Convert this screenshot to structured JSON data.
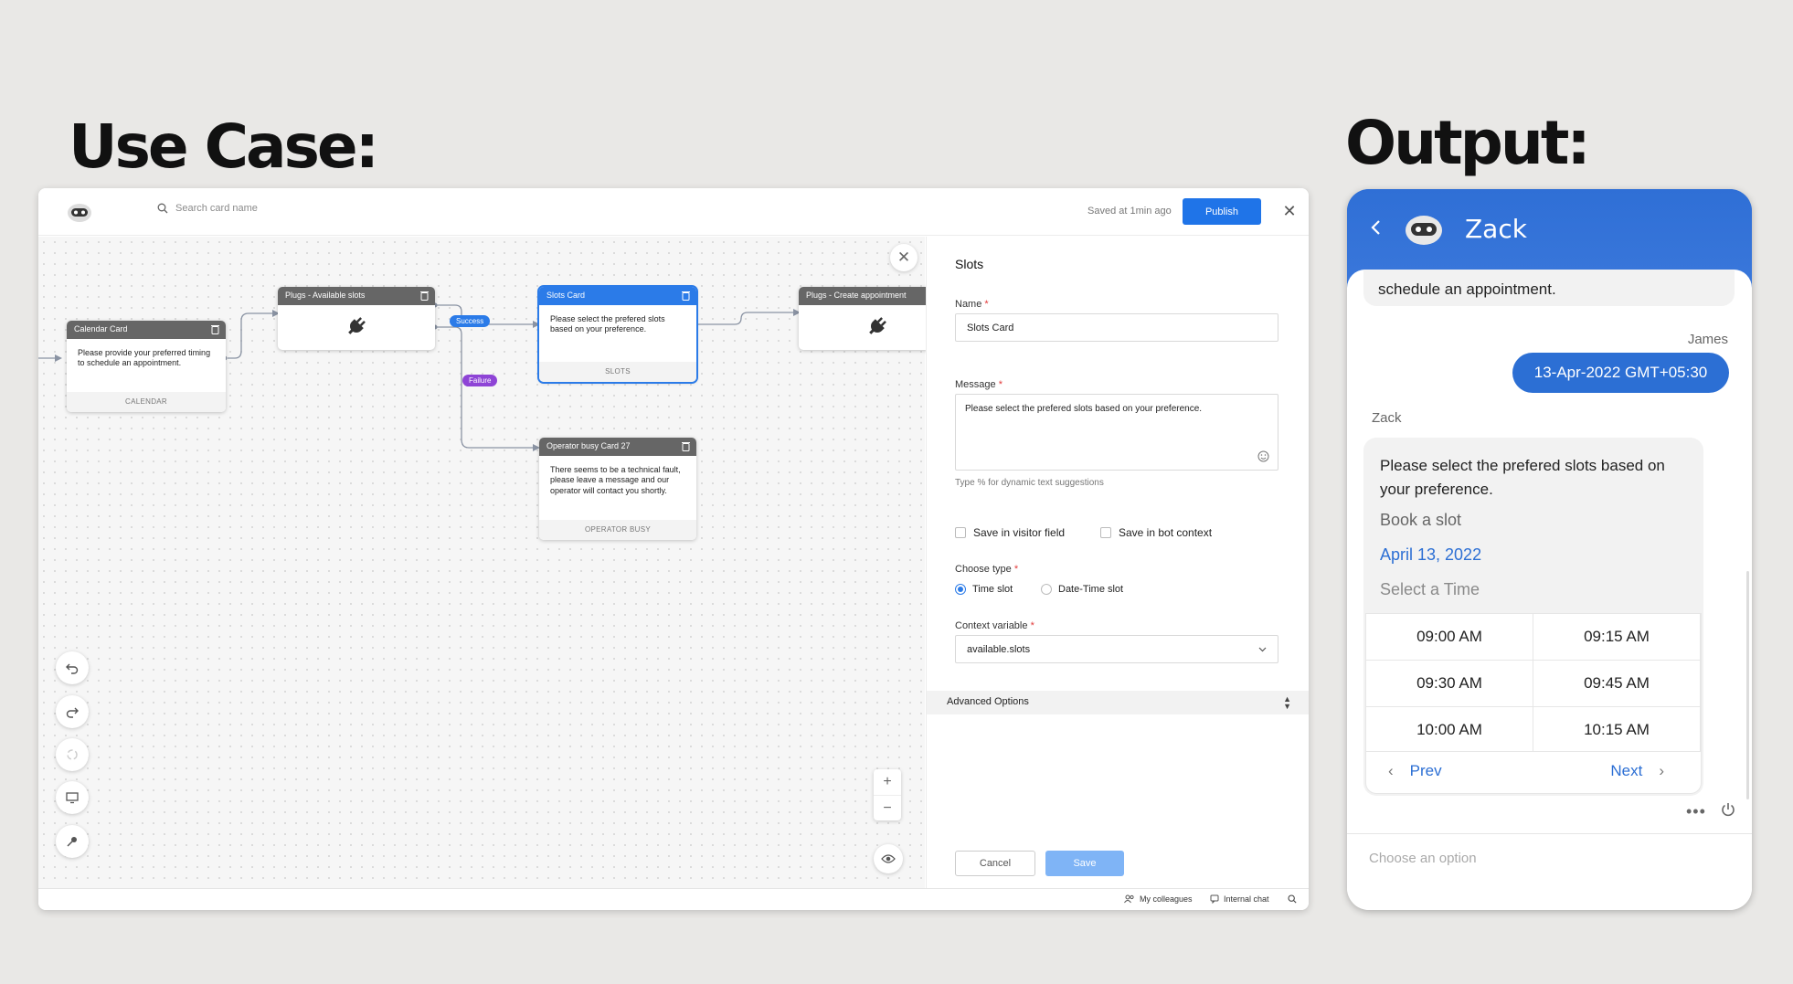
{
  "headings": {
    "use_case": "Use Case:",
    "output": "Output:"
  },
  "builder": {
    "search_placeholder": "Search card name",
    "saved_status": "Saved at 1min ago",
    "publish_label": "Publish",
    "cards": {
      "calendar": {
        "title": "Calendar Card",
        "body": "Please provide your preferred timing to schedule an appointment.",
        "footer": "CALENDAR"
      },
      "plugs_available": {
        "title": "Plugs - Available slots"
      },
      "slots": {
        "title": "Slots Card",
        "body": "Please select the prefered slots based on your preference.",
        "footer": "SLOTS"
      },
      "plugs_create": {
        "title": "Plugs - Create appointment"
      },
      "operator_busy": {
        "title": "Operator busy Card 27",
        "body": "There seems to be a technical fault, please leave a message and our operator will contact you shortly.",
        "footer": "OPERATOR BUSY"
      }
    },
    "edge_labels": {
      "success": "Success",
      "failure": "Failure"
    },
    "panel": {
      "title": "Slots",
      "name_label": "Name",
      "name_value": "Slots Card",
      "message_label": "Message",
      "message_value": "Please select the prefered slots based on your preference.",
      "hint": "Type % for dynamic text suggestions",
      "save_visitor": "Save in visitor field",
      "save_bot": "Save in bot context",
      "choose_type_label": "Choose type",
      "type_options": [
        "Time slot",
        "Date-Time slot"
      ],
      "selected_type": "Time slot",
      "context_label": "Context variable",
      "context_value": "available.slots",
      "advanced": "Advanced Options",
      "cancel": "Cancel",
      "save": "Save"
    },
    "statusbar": {
      "colleagues": "My colleagues",
      "internal_chat": "Internal chat"
    }
  },
  "chat": {
    "bot_name": "Zack",
    "previous_text": "schedule an appointment.",
    "user_name": "James",
    "user_message": "13-Apr-2022 GMT+05:30",
    "bot_label": "Zack",
    "bot_message": "Please select the prefered slots based on your preference.",
    "book_label": "Book a slot",
    "date": "April 13, 2022",
    "select_time": "Select a Time",
    "slots": [
      "09:00 AM",
      "09:15 AM",
      "09:30 AM",
      "09:45 AM",
      "10:00 AM",
      "10:15 AM"
    ],
    "prev": "Prev",
    "next": "Next",
    "input_placeholder": "Choose an option"
  },
  "colors": {
    "accent": "#1f74e8",
    "chat_header": "#2f6fd6",
    "failure": "#8e44d6"
  }
}
